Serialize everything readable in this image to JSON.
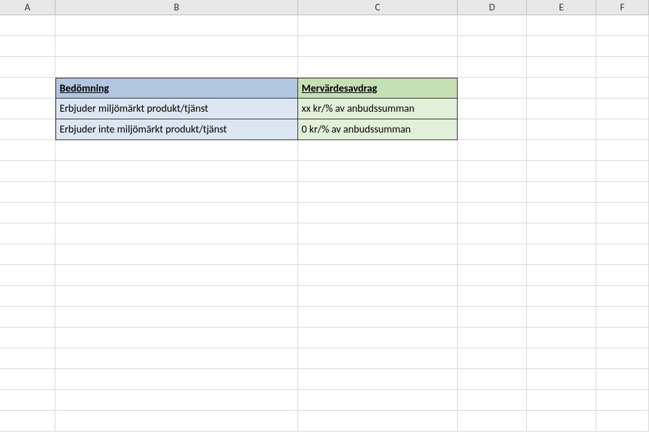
{
  "columns": [
    "A",
    "B",
    "C",
    "D",
    "E",
    "F"
  ],
  "table": {
    "headers": {
      "b": "Bedömning",
      "c": "Mervärdesavdrag"
    },
    "rows": [
      {
        "b": "Erbjuder miljömärkt produkt/tjänst",
        "c": "xx kr/% av anbudssumman"
      },
      {
        "b": "Erbjuder inte miljömärkt produkt/tjänst",
        "c": "0 kr/% av anbudssumman"
      }
    ]
  }
}
